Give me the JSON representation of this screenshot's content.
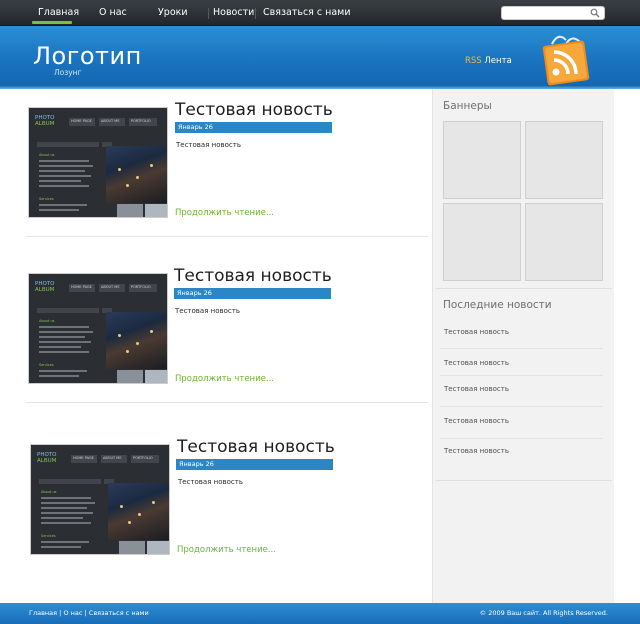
{
  "nav": {
    "items": [
      {
        "label": "Главная",
        "active": true
      },
      {
        "label": "О нас",
        "active": false
      },
      {
        "label": "Уроки",
        "active": false
      },
      {
        "label": "Новости",
        "active": false
      },
      {
        "label": "Связаться с нами",
        "active": false
      }
    ],
    "search": {
      "placeholder": "",
      "icon": "search-icon"
    }
  },
  "header": {
    "logo": "Логотип",
    "slogan": "Лозунг",
    "rss_prefix": "RSS",
    "rss_label": "Лента",
    "rss_icon": "rss-bag-icon"
  },
  "posts": [
    {
      "title": "Тестовая новость",
      "date": "Январь 26",
      "text": "Тестовая новость",
      "more": "Продолжить чтение..."
    },
    {
      "title": "Тестовая новость",
      "date": "Январь 26",
      "text": "Тестовая новость",
      "more": "Продолжить чтение..."
    },
    {
      "title": "Тестовая новость",
      "date": "Январь 26",
      "text": "Тестовая новость",
      "more": "Продолжить чтение..."
    }
  ],
  "thumbnail": {
    "brand_line1": "PHOTO",
    "brand_line2": "ALBUM",
    "nav": [
      "HOME PAGE",
      "ABOUT ME",
      "PORTFOLIO"
    ],
    "label1": "About us",
    "label2": "Services"
  },
  "sidebar": {
    "banners_title": "Баннеры",
    "latest_title": "Последние новости",
    "latest": [
      "Тестовая новость",
      "Тестовая новость",
      "Тестовая новость",
      "Тестовая новость",
      "Тестовая новость"
    ]
  },
  "footer": {
    "links": [
      "Главная",
      "О нас",
      "Связаться с нами"
    ],
    "separator": "|",
    "copyright": "© 2009 Ваш сайт. All Rights Reserved."
  },
  "colors": {
    "accent_blue": "#2a86c4",
    "link_green": "#6ab42d",
    "nav_active": "#7ac143",
    "rss_orange": "#f4b63f"
  }
}
